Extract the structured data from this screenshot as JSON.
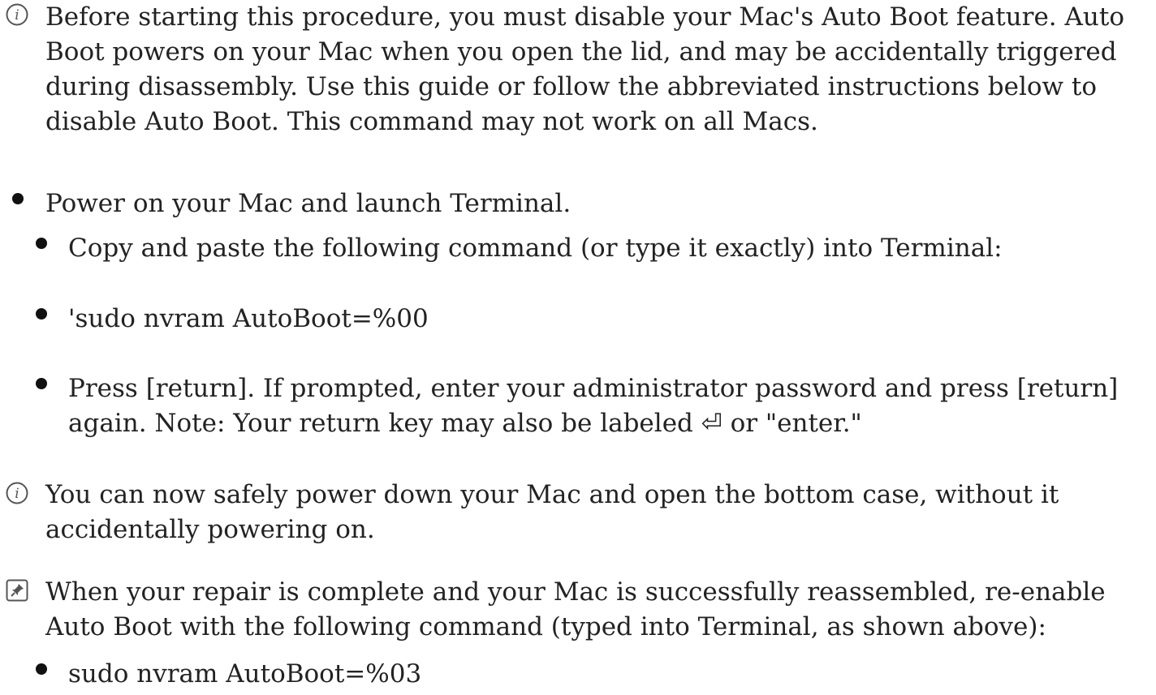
{
  "lines": {
    "note1": "Before starting this procedure, you must disable your Mac's Auto Boot feature. Auto Boot powers on your Mac when you open the lid, and may be accidentally triggered during disassembly. Use this guide or follow the abbreviated instructions below to disable Auto Boot. This command may not work on all Macs.",
    "step1": "Power on your Mac and launch Terminal.",
    "step1a": "Copy and paste the following command (or type it exactly) into Terminal:",
    "step1b": "'sudo nvram AutoBoot=%00",
    "step1c": "Press [return]. If prompted, enter your administrator password and press [return] again. Note: Your return key may also be labeled ⏎ or \"enter.\"",
    "note2": "You can now safely power down your Mac and open the bottom case, without it accidentally powering on.",
    "reminder": "When your repair is complete and your Mac is successfully reassembled, re-enable Auto Boot with the following command (typed into Terminal, as shown above):",
    "reminder_cmd": "sudo nvram AutoBoot=%03"
  },
  "icons": {
    "info": "info-icon",
    "reminder": "pin-icon"
  },
  "colors": {
    "text": "#222222",
    "icon": "#555555"
  }
}
